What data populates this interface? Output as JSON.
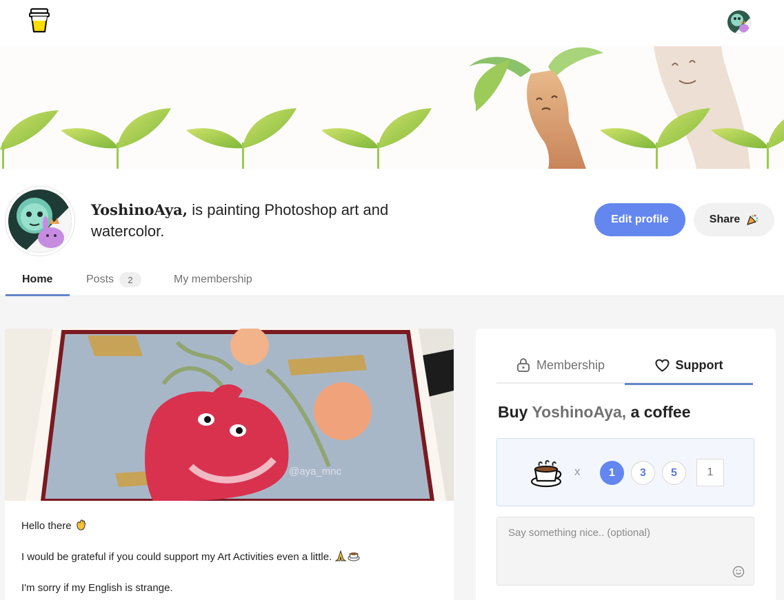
{
  "topbar": {
    "logo_icon": "coffee-cup-logo-icon",
    "avatar_icon": "user-avatar-icon"
  },
  "profile": {
    "name": "YoshinoAya,",
    "tagline": " is painting Photoshop art and watercolor.",
    "edit_label": "Edit profile",
    "share_label": "Share",
    "share_icon": "party-popper-icon"
  },
  "tabs": [
    {
      "label": "Home"
    },
    {
      "label": "Posts",
      "count": "2"
    },
    {
      "label": "My membership"
    }
  ],
  "post": {
    "image_watermark": "@aya_mnc",
    "lines": [
      "Hello there",
      " I would be grateful if you could support my Art Activities even a little.",
      "I'm sorry if my English is strange."
    ]
  },
  "support": {
    "tabs": [
      {
        "label": "Membership",
        "icon": "lock-icon"
      },
      {
        "label": "Support",
        "icon": "heart-icon"
      }
    ],
    "title_prefix": "Buy ",
    "title_name": "YoshinoAya,",
    "title_suffix": " a coffee",
    "times": "x",
    "quantities": [
      "1",
      "3",
      "5"
    ],
    "selected_quantity": "1",
    "custom_quantity_placeholder": "1",
    "message_placeholder": "Say something nice.. (optional)"
  },
  "colors": {
    "accent": "#6387ef",
    "tab_underline": "#6385c9"
  }
}
